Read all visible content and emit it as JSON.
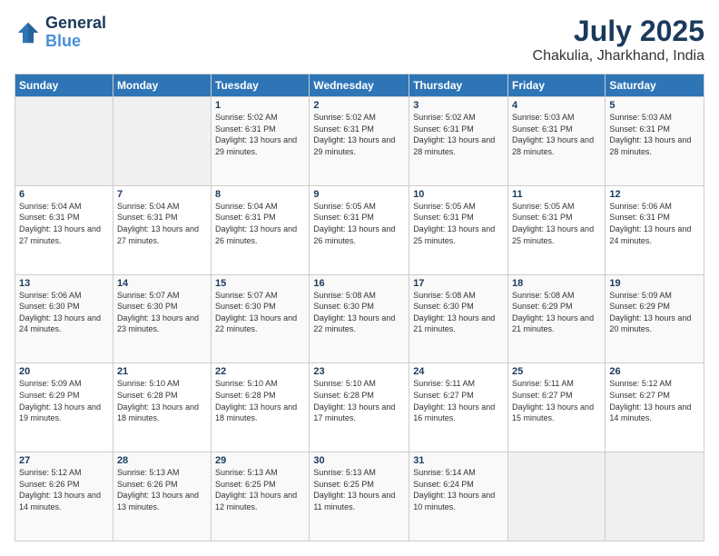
{
  "logo": {
    "line1": "General",
    "line2": "Blue"
  },
  "title": "July 2025",
  "subtitle": "Chakulia, Jharkhand, India",
  "weekdays": [
    "Sunday",
    "Monday",
    "Tuesday",
    "Wednesday",
    "Thursday",
    "Friday",
    "Saturday"
  ],
  "weeks": [
    [
      {
        "day": "",
        "sunrise": "",
        "sunset": "",
        "daylight": ""
      },
      {
        "day": "",
        "sunrise": "",
        "sunset": "",
        "daylight": ""
      },
      {
        "day": "1",
        "sunrise": "Sunrise: 5:02 AM",
        "sunset": "Sunset: 6:31 PM",
        "daylight": "Daylight: 13 hours and 29 minutes."
      },
      {
        "day": "2",
        "sunrise": "Sunrise: 5:02 AM",
        "sunset": "Sunset: 6:31 PM",
        "daylight": "Daylight: 13 hours and 29 minutes."
      },
      {
        "day": "3",
        "sunrise": "Sunrise: 5:02 AM",
        "sunset": "Sunset: 6:31 PM",
        "daylight": "Daylight: 13 hours and 28 minutes."
      },
      {
        "day": "4",
        "sunrise": "Sunrise: 5:03 AM",
        "sunset": "Sunset: 6:31 PM",
        "daylight": "Daylight: 13 hours and 28 minutes."
      },
      {
        "day": "5",
        "sunrise": "Sunrise: 5:03 AM",
        "sunset": "Sunset: 6:31 PM",
        "daylight": "Daylight: 13 hours and 28 minutes."
      }
    ],
    [
      {
        "day": "6",
        "sunrise": "Sunrise: 5:04 AM",
        "sunset": "Sunset: 6:31 PM",
        "daylight": "Daylight: 13 hours and 27 minutes."
      },
      {
        "day": "7",
        "sunrise": "Sunrise: 5:04 AM",
        "sunset": "Sunset: 6:31 PM",
        "daylight": "Daylight: 13 hours and 27 minutes."
      },
      {
        "day": "8",
        "sunrise": "Sunrise: 5:04 AM",
        "sunset": "Sunset: 6:31 PM",
        "daylight": "Daylight: 13 hours and 26 minutes."
      },
      {
        "day": "9",
        "sunrise": "Sunrise: 5:05 AM",
        "sunset": "Sunset: 6:31 PM",
        "daylight": "Daylight: 13 hours and 26 minutes."
      },
      {
        "day": "10",
        "sunrise": "Sunrise: 5:05 AM",
        "sunset": "Sunset: 6:31 PM",
        "daylight": "Daylight: 13 hours and 25 minutes."
      },
      {
        "day": "11",
        "sunrise": "Sunrise: 5:05 AM",
        "sunset": "Sunset: 6:31 PM",
        "daylight": "Daylight: 13 hours and 25 minutes."
      },
      {
        "day": "12",
        "sunrise": "Sunrise: 5:06 AM",
        "sunset": "Sunset: 6:31 PM",
        "daylight": "Daylight: 13 hours and 24 minutes."
      }
    ],
    [
      {
        "day": "13",
        "sunrise": "Sunrise: 5:06 AM",
        "sunset": "Sunset: 6:30 PM",
        "daylight": "Daylight: 13 hours and 24 minutes."
      },
      {
        "day": "14",
        "sunrise": "Sunrise: 5:07 AM",
        "sunset": "Sunset: 6:30 PM",
        "daylight": "Daylight: 13 hours and 23 minutes."
      },
      {
        "day": "15",
        "sunrise": "Sunrise: 5:07 AM",
        "sunset": "Sunset: 6:30 PM",
        "daylight": "Daylight: 13 hours and 22 minutes."
      },
      {
        "day": "16",
        "sunrise": "Sunrise: 5:08 AM",
        "sunset": "Sunset: 6:30 PM",
        "daylight": "Daylight: 13 hours and 22 minutes."
      },
      {
        "day": "17",
        "sunrise": "Sunrise: 5:08 AM",
        "sunset": "Sunset: 6:30 PM",
        "daylight": "Daylight: 13 hours and 21 minutes."
      },
      {
        "day": "18",
        "sunrise": "Sunrise: 5:08 AM",
        "sunset": "Sunset: 6:29 PM",
        "daylight": "Daylight: 13 hours and 21 minutes."
      },
      {
        "day": "19",
        "sunrise": "Sunrise: 5:09 AM",
        "sunset": "Sunset: 6:29 PM",
        "daylight": "Daylight: 13 hours and 20 minutes."
      }
    ],
    [
      {
        "day": "20",
        "sunrise": "Sunrise: 5:09 AM",
        "sunset": "Sunset: 6:29 PM",
        "daylight": "Daylight: 13 hours and 19 minutes."
      },
      {
        "day": "21",
        "sunrise": "Sunrise: 5:10 AM",
        "sunset": "Sunset: 6:28 PM",
        "daylight": "Daylight: 13 hours and 18 minutes."
      },
      {
        "day": "22",
        "sunrise": "Sunrise: 5:10 AM",
        "sunset": "Sunset: 6:28 PM",
        "daylight": "Daylight: 13 hours and 18 minutes."
      },
      {
        "day": "23",
        "sunrise": "Sunrise: 5:10 AM",
        "sunset": "Sunset: 6:28 PM",
        "daylight": "Daylight: 13 hours and 17 minutes."
      },
      {
        "day": "24",
        "sunrise": "Sunrise: 5:11 AM",
        "sunset": "Sunset: 6:27 PM",
        "daylight": "Daylight: 13 hours and 16 minutes."
      },
      {
        "day": "25",
        "sunrise": "Sunrise: 5:11 AM",
        "sunset": "Sunset: 6:27 PM",
        "daylight": "Daylight: 13 hours and 15 minutes."
      },
      {
        "day": "26",
        "sunrise": "Sunrise: 5:12 AM",
        "sunset": "Sunset: 6:27 PM",
        "daylight": "Daylight: 13 hours and 14 minutes."
      }
    ],
    [
      {
        "day": "27",
        "sunrise": "Sunrise: 5:12 AM",
        "sunset": "Sunset: 6:26 PM",
        "daylight": "Daylight: 13 hours and 14 minutes."
      },
      {
        "day": "28",
        "sunrise": "Sunrise: 5:13 AM",
        "sunset": "Sunset: 6:26 PM",
        "daylight": "Daylight: 13 hours and 13 minutes."
      },
      {
        "day": "29",
        "sunrise": "Sunrise: 5:13 AM",
        "sunset": "Sunset: 6:25 PM",
        "daylight": "Daylight: 13 hours and 12 minutes."
      },
      {
        "day": "30",
        "sunrise": "Sunrise: 5:13 AM",
        "sunset": "Sunset: 6:25 PM",
        "daylight": "Daylight: 13 hours and 11 minutes."
      },
      {
        "day": "31",
        "sunrise": "Sunrise: 5:14 AM",
        "sunset": "Sunset: 6:24 PM",
        "daylight": "Daylight: 13 hours and 10 minutes."
      },
      {
        "day": "",
        "sunrise": "",
        "sunset": "",
        "daylight": ""
      },
      {
        "day": "",
        "sunrise": "",
        "sunset": "",
        "daylight": ""
      }
    ]
  ]
}
